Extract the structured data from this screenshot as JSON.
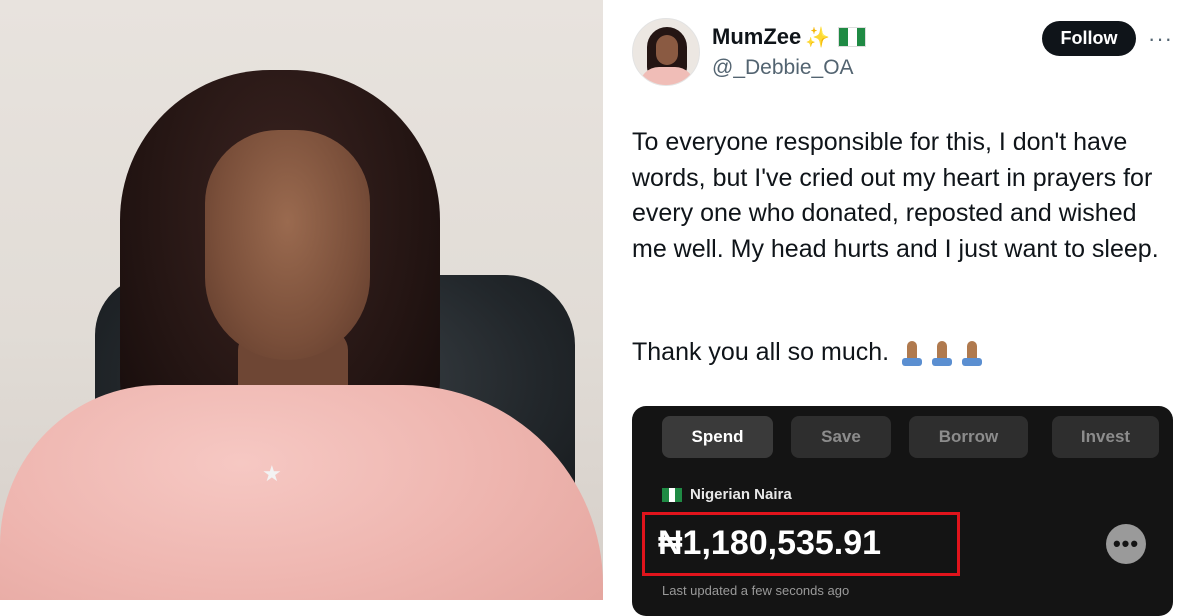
{
  "tweet": {
    "display_name": "MumZee",
    "name_emojis": [
      "sparkles",
      "nigeria-flag"
    ],
    "handle": "@_Debbie_OA",
    "follow_label": "Follow",
    "more_label": "···",
    "text": "To everyone responsible for this, I don't have words, but I've cried out my heart in prayers for every one who donated, reposted and wished me well. My head hurts and I just want to sleep.",
    "thanks": "Thank you all so much.",
    "thanks_emojis": [
      "folded-hands",
      "folded-hands",
      "folded-hands"
    ]
  },
  "bank_app": {
    "tabs": [
      {
        "label": "Spend",
        "active": true
      },
      {
        "label": "Save",
        "active": false
      },
      {
        "label": "Borrow",
        "active": false
      },
      {
        "label": "Invest",
        "active": false
      }
    ],
    "currency_label": "Nigerian Naira",
    "balance": "₦1,180,535.91",
    "last_updated": "Last updated a few seconds ago",
    "more_label": "•••",
    "highlight_color": "#e0141c"
  },
  "colors": {
    "follow_button": "#0f1419",
    "card_background": "#141414",
    "text_primary": "#0f1419",
    "text_secondary": "#536471"
  }
}
